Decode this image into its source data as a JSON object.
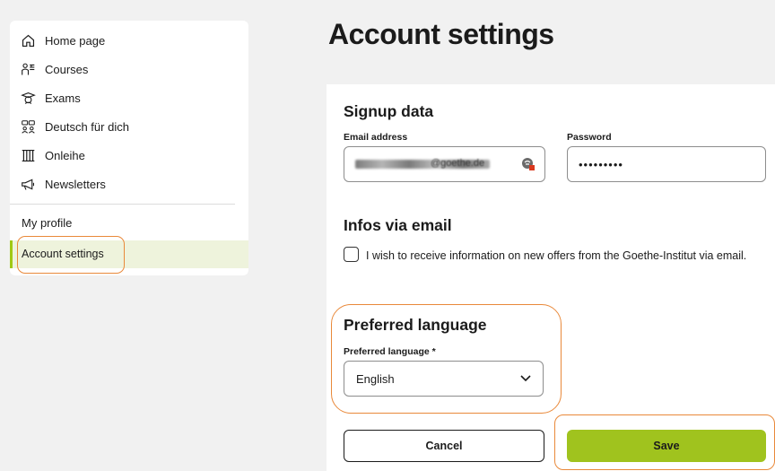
{
  "sidebar": {
    "items": [
      {
        "label": "Home page",
        "icon": "home-icon"
      },
      {
        "label": "Courses",
        "icon": "courses-icon"
      },
      {
        "label": "Exams",
        "icon": "exams-icon"
      },
      {
        "label": "Deutsch für dich",
        "icon": "community-icon"
      },
      {
        "label": "Onleihe",
        "icon": "library-icon"
      },
      {
        "label": "Newsletters",
        "icon": "megaphone-icon"
      }
    ],
    "my_profile": "My profile",
    "account_settings": "Account settings"
  },
  "main": {
    "title": "Account settings",
    "signup": {
      "title": "Signup data",
      "email_label": "Email address",
      "email_domain": "@goethe.de",
      "password_label": "Password",
      "password_value": "•••••••••"
    },
    "infos": {
      "title": "Infos via email",
      "checkbox_text": "I wish to receive information on new offers from the Goethe-Institut via email."
    },
    "language": {
      "title": "Preferred language",
      "label": "Preferred language *",
      "value": "English"
    },
    "buttons": {
      "cancel": "Cancel",
      "save": "Save"
    }
  },
  "colors": {
    "accent_green": "#a0c31e",
    "highlight_orange": "#e9893a",
    "active_bg": "#eef3dc"
  }
}
